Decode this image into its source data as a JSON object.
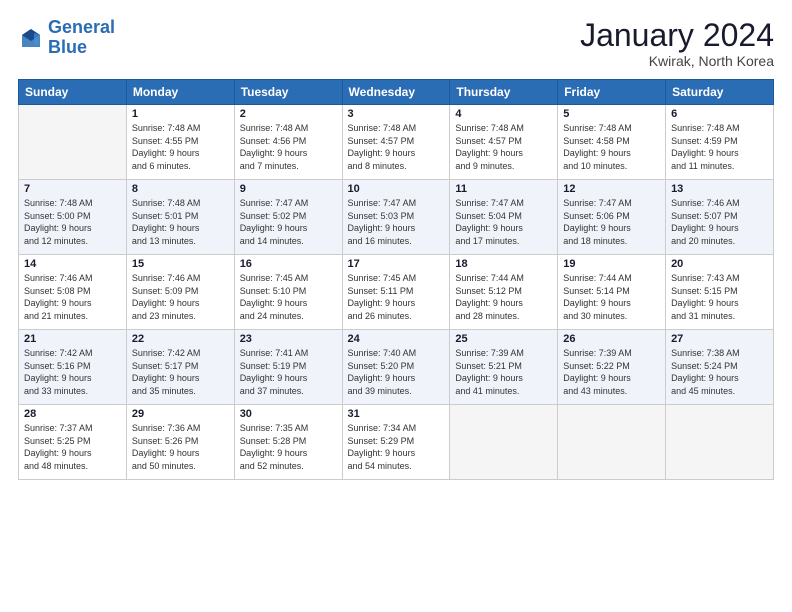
{
  "logo": {
    "line1": "General",
    "line2": "Blue"
  },
  "title": "January 2024",
  "subtitle": "Kwirak, North Korea",
  "days_of_week": [
    "Sunday",
    "Monday",
    "Tuesday",
    "Wednesday",
    "Thursday",
    "Friday",
    "Saturday"
  ],
  "weeks": [
    [
      {
        "num": "",
        "sunrise": "",
        "sunset": "",
        "daylight": "",
        "empty": true
      },
      {
        "num": "1",
        "sunrise": "Sunrise: 7:48 AM",
        "sunset": "Sunset: 4:55 PM",
        "daylight": "Daylight: 9 hours and 6 minutes."
      },
      {
        "num": "2",
        "sunrise": "Sunrise: 7:48 AM",
        "sunset": "Sunset: 4:56 PM",
        "daylight": "Daylight: 9 hours and 7 minutes."
      },
      {
        "num": "3",
        "sunrise": "Sunrise: 7:48 AM",
        "sunset": "Sunset: 4:57 PM",
        "daylight": "Daylight: 9 hours and 8 minutes."
      },
      {
        "num": "4",
        "sunrise": "Sunrise: 7:48 AM",
        "sunset": "Sunset: 4:57 PM",
        "daylight": "Daylight: 9 hours and 9 minutes."
      },
      {
        "num": "5",
        "sunrise": "Sunrise: 7:48 AM",
        "sunset": "Sunset: 4:58 PM",
        "daylight": "Daylight: 9 hours and 10 minutes."
      },
      {
        "num": "6",
        "sunrise": "Sunrise: 7:48 AM",
        "sunset": "Sunset: 4:59 PM",
        "daylight": "Daylight: 9 hours and 11 minutes."
      }
    ],
    [
      {
        "num": "7",
        "sunrise": "Sunrise: 7:48 AM",
        "sunset": "Sunset: 5:00 PM",
        "daylight": "Daylight: 9 hours and 12 minutes."
      },
      {
        "num": "8",
        "sunrise": "Sunrise: 7:48 AM",
        "sunset": "Sunset: 5:01 PM",
        "daylight": "Daylight: 9 hours and 13 minutes."
      },
      {
        "num": "9",
        "sunrise": "Sunrise: 7:47 AM",
        "sunset": "Sunset: 5:02 PM",
        "daylight": "Daylight: 9 hours and 14 minutes."
      },
      {
        "num": "10",
        "sunrise": "Sunrise: 7:47 AM",
        "sunset": "Sunset: 5:03 PM",
        "daylight": "Daylight: 9 hours and 16 minutes."
      },
      {
        "num": "11",
        "sunrise": "Sunrise: 7:47 AM",
        "sunset": "Sunset: 5:04 PM",
        "daylight": "Daylight: 9 hours and 17 minutes."
      },
      {
        "num": "12",
        "sunrise": "Sunrise: 7:47 AM",
        "sunset": "Sunset: 5:06 PM",
        "daylight": "Daylight: 9 hours and 18 minutes."
      },
      {
        "num": "13",
        "sunrise": "Sunrise: 7:46 AM",
        "sunset": "Sunset: 5:07 PM",
        "daylight": "Daylight: 9 hours and 20 minutes."
      }
    ],
    [
      {
        "num": "14",
        "sunrise": "Sunrise: 7:46 AM",
        "sunset": "Sunset: 5:08 PM",
        "daylight": "Daylight: 9 hours and 21 minutes."
      },
      {
        "num": "15",
        "sunrise": "Sunrise: 7:46 AM",
        "sunset": "Sunset: 5:09 PM",
        "daylight": "Daylight: 9 hours and 23 minutes."
      },
      {
        "num": "16",
        "sunrise": "Sunrise: 7:45 AM",
        "sunset": "Sunset: 5:10 PM",
        "daylight": "Daylight: 9 hours and 24 minutes."
      },
      {
        "num": "17",
        "sunrise": "Sunrise: 7:45 AM",
        "sunset": "Sunset: 5:11 PM",
        "daylight": "Daylight: 9 hours and 26 minutes."
      },
      {
        "num": "18",
        "sunrise": "Sunrise: 7:44 AM",
        "sunset": "Sunset: 5:12 PM",
        "daylight": "Daylight: 9 hours and 28 minutes."
      },
      {
        "num": "19",
        "sunrise": "Sunrise: 7:44 AM",
        "sunset": "Sunset: 5:14 PM",
        "daylight": "Daylight: 9 hours and 30 minutes."
      },
      {
        "num": "20",
        "sunrise": "Sunrise: 7:43 AM",
        "sunset": "Sunset: 5:15 PM",
        "daylight": "Daylight: 9 hours and 31 minutes."
      }
    ],
    [
      {
        "num": "21",
        "sunrise": "Sunrise: 7:42 AM",
        "sunset": "Sunset: 5:16 PM",
        "daylight": "Daylight: 9 hours and 33 minutes."
      },
      {
        "num": "22",
        "sunrise": "Sunrise: 7:42 AM",
        "sunset": "Sunset: 5:17 PM",
        "daylight": "Daylight: 9 hours and 35 minutes."
      },
      {
        "num": "23",
        "sunrise": "Sunrise: 7:41 AM",
        "sunset": "Sunset: 5:19 PM",
        "daylight": "Daylight: 9 hours and 37 minutes."
      },
      {
        "num": "24",
        "sunrise": "Sunrise: 7:40 AM",
        "sunset": "Sunset: 5:20 PM",
        "daylight": "Daylight: 9 hours and 39 minutes."
      },
      {
        "num": "25",
        "sunrise": "Sunrise: 7:39 AM",
        "sunset": "Sunset: 5:21 PM",
        "daylight": "Daylight: 9 hours and 41 minutes."
      },
      {
        "num": "26",
        "sunrise": "Sunrise: 7:39 AM",
        "sunset": "Sunset: 5:22 PM",
        "daylight": "Daylight: 9 hours and 43 minutes."
      },
      {
        "num": "27",
        "sunrise": "Sunrise: 7:38 AM",
        "sunset": "Sunset: 5:24 PM",
        "daylight": "Daylight: 9 hours and 45 minutes."
      }
    ],
    [
      {
        "num": "28",
        "sunrise": "Sunrise: 7:37 AM",
        "sunset": "Sunset: 5:25 PM",
        "daylight": "Daylight: 9 hours and 48 minutes."
      },
      {
        "num": "29",
        "sunrise": "Sunrise: 7:36 AM",
        "sunset": "Sunset: 5:26 PM",
        "daylight": "Daylight: 9 hours and 50 minutes."
      },
      {
        "num": "30",
        "sunrise": "Sunrise: 7:35 AM",
        "sunset": "Sunset: 5:28 PM",
        "daylight": "Daylight: 9 hours and 52 minutes."
      },
      {
        "num": "31",
        "sunrise": "Sunrise: 7:34 AM",
        "sunset": "Sunset: 5:29 PM",
        "daylight": "Daylight: 9 hours and 54 minutes."
      },
      {
        "num": "",
        "sunrise": "",
        "sunset": "",
        "daylight": "",
        "empty": true
      },
      {
        "num": "",
        "sunrise": "",
        "sunset": "",
        "daylight": "",
        "empty": true
      },
      {
        "num": "",
        "sunrise": "",
        "sunset": "",
        "daylight": "",
        "empty": true
      }
    ]
  ]
}
